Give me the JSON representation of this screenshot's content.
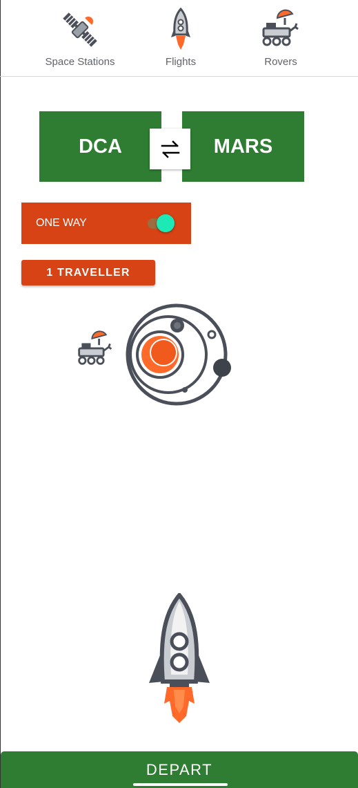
{
  "tabs": [
    {
      "label": "Space Stations",
      "icon": "satellite-icon"
    },
    {
      "label": "Flights",
      "icon": "rocket-icon"
    },
    {
      "label": "Rovers",
      "icon": "rover-icon"
    }
  ],
  "route": {
    "from": "DCA",
    "to": "MARS",
    "swap_icon": "swap-arrows-icon"
  },
  "trip_type": {
    "label": "ONE WAY",
    "toggle_on": true
  },
  "travellers": {
    "label": "1 TRAVELLER"
  },
  "illustration": {
    "rover_icon": "rover-icon",
    "planet_icon": "mars-orbit-icon",
    "rocket_icon": "rocket-icon"
  },
  "depart": {
    "label": "DEPART"
  },
  "colors": {
    "green": "#2e7d32",
    "orange": "#d84315",
    "accent": "#1de9b6",
    "icon_gray": "#4a4f59",
    "icon_orange": "#ff6a2a"
  }
}
